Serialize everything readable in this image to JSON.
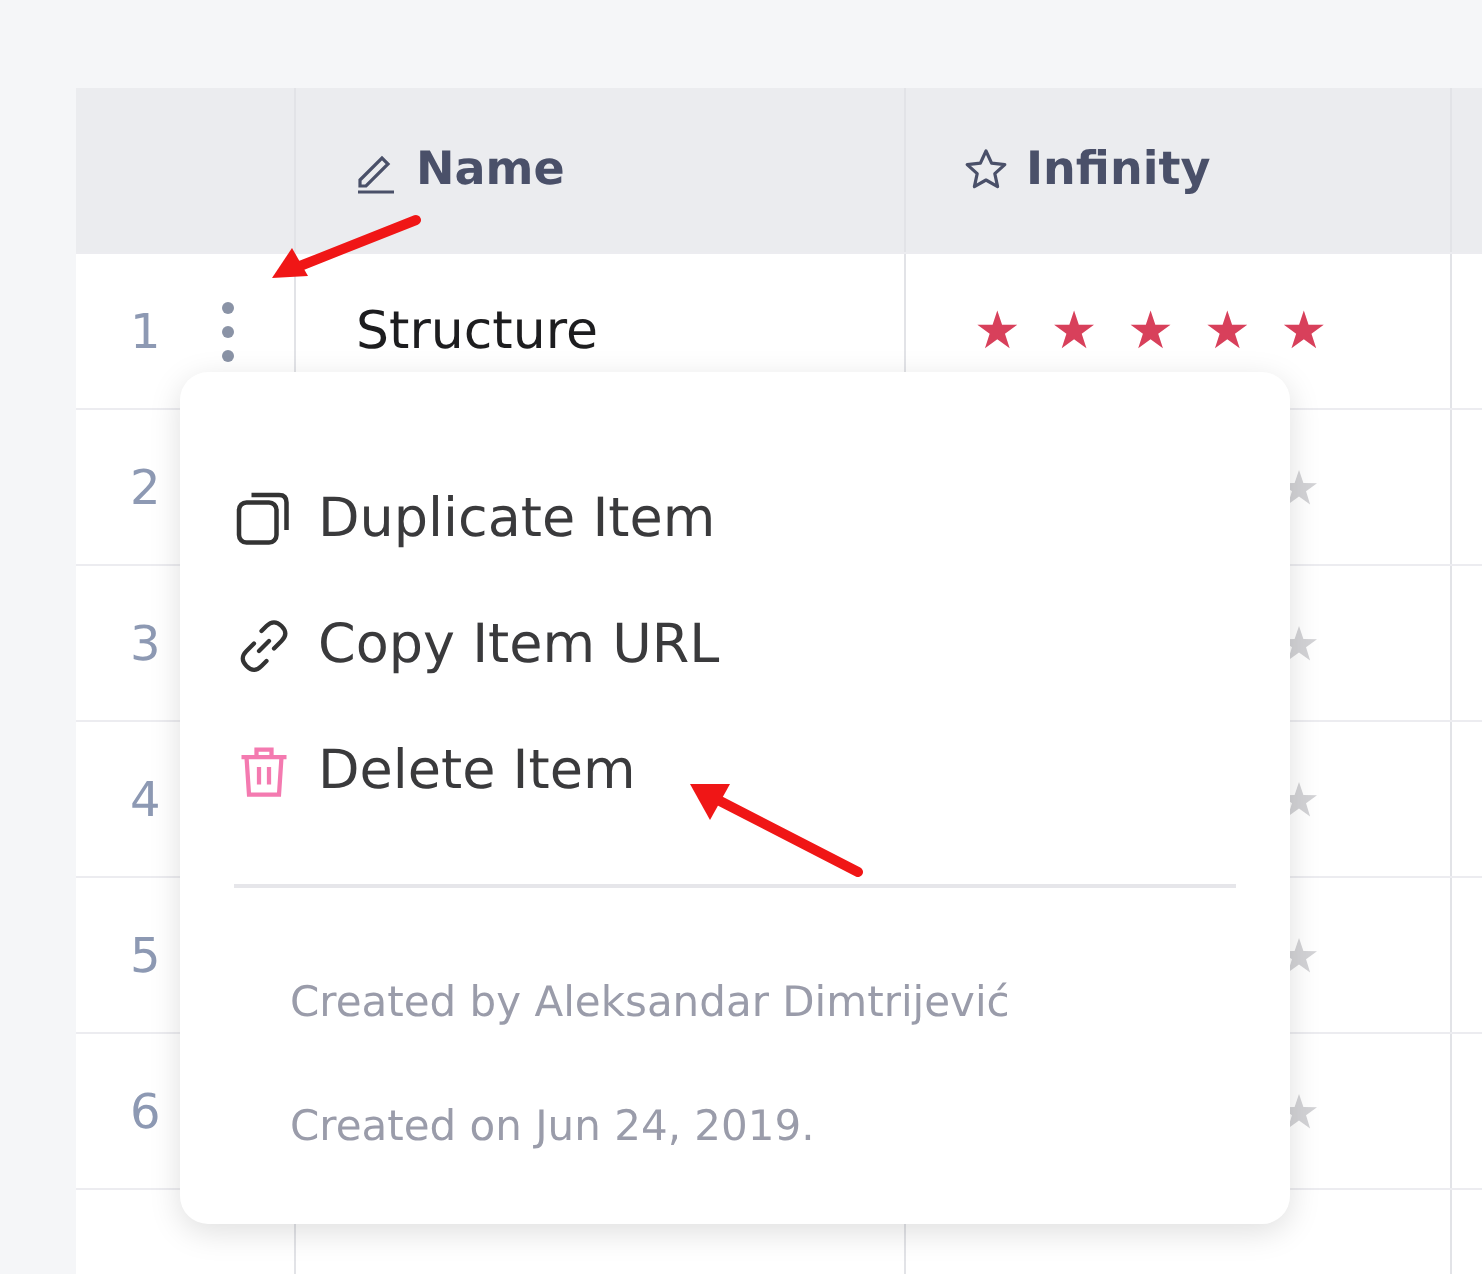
{
  "table": {
    "columns": [
      {
        "label": "Name",
        "kind": "text"
      },
      {
        "label": "Infinity",
        "kind": "rating"
      }
    ],
    "rows": [
      {
        "index": "1",
        "name": "Structure",
        "stars": 5,
        "menu": true
      },
      {
        "index": "2"
      },
      {
        "index": "3"
      },
      {
        "index": "4"
      },
      {
        "index": "5"
      },
      {
        "index": "6"
      }
    ]
  },
  "context_menu": {
    "items": [
      {
        "label": "Duplicate Item",
        "kind": "duplicate"
      },
      {
        "label": "Copy Item URL",
        "kind": "link"
      },
      {
        "label": "Delete Item",
        "kind": "delete"
      }
    ],
    "footer": [
      "Created by Aleksandar Dimtrijević",
      "Created on Jun 24, 2019."
    ]
  }
}
